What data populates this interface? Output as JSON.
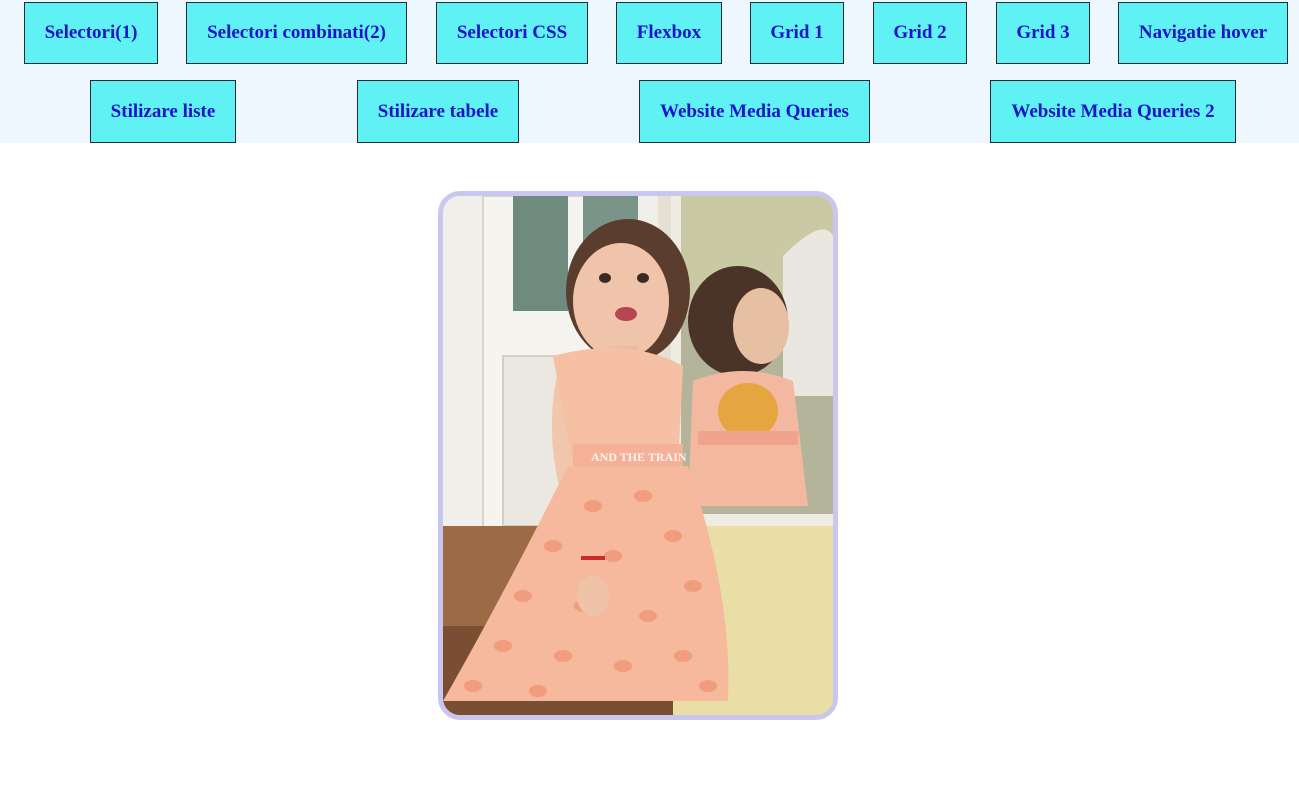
{
  "nav": {
    "row1": [
      {
        "label": "Selectori(1)"
      },
      {
        "label": "Selectori combinati(2)"
      },
      {
        "label": "Selectori CSS"
      },
      {
        "label": "Flexbox"
      },
      {
        "label": "Grid 1"
      },
      {
        "label": "Grid 2"
      },
      {
        "label": "Grid 3"
      },
      {
        "label": "Navigatie hover"
      }
    ],
    "row2": [
      {
        "label": "Stilizare liste"
      },
      {
        "label": "Stilizare tabele"
      },
      {
        "label": "Website Media Queries"
      },
      {
        "label": "Website Media Queries 2"
      }
    ]
  },
  "photo": {
    "dress_print": "AND THE TRAIN"
  },
  "colors": {
    "nav_background": "#eef6fe",
    "button_background": "#5ff1f4",
    "button_text": "#1b14c8",
    "photo_border": "#c9c7ef"
  }
}
